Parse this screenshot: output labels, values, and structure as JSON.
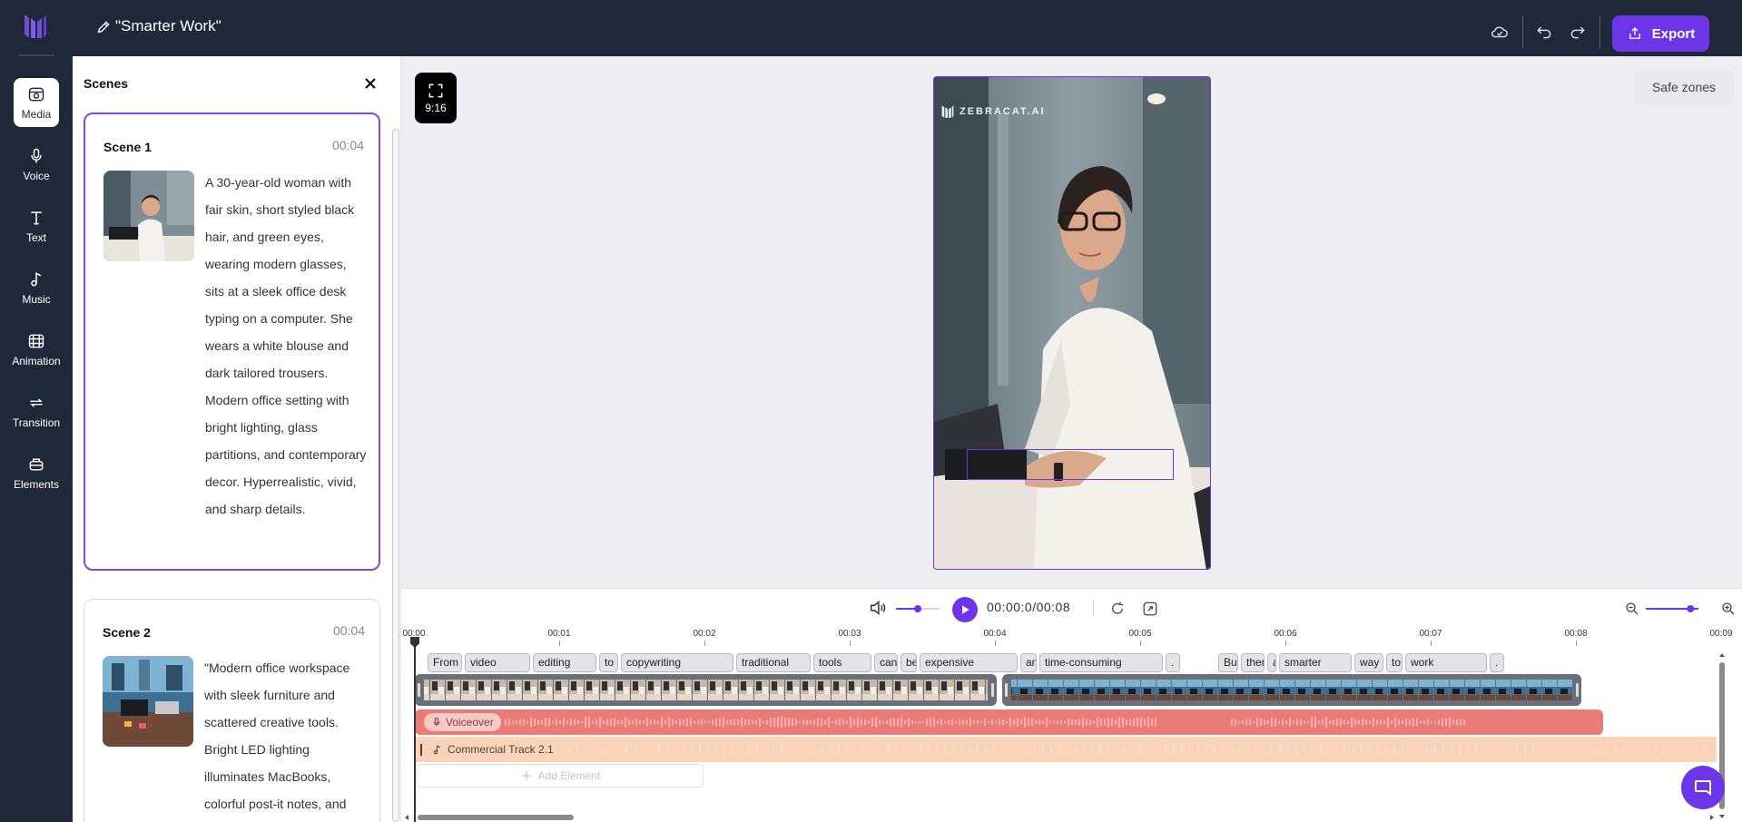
{
  "header": {
    "project_title": "\"Smarter Work\"",
    "export_label": "Export",
    "icons": [
      "cloud-check-icon",
      "undo-icon",
      "redo-icon",
      "export-upload-icon"
    ]
  },
  "sidebar": {
    "items": [
      {
        "label": "Media",
        "icon": "media-icon",
        "active": true
      },
      {
        "label": "Voice",
        "icon": "microphone-icon"
      },
      {
        "label": "Text",
        "icon": "text-icon"
      },
      {
        "label": "Music",
        "icon": "music-note-icon"
      },
      {
        "label": "Animation",
        "icon": "film-icon"
      },
      {
        "label": "Transition",
        "icon": "transition-icon"
      },
      {
        "label": "Elements",
        "icon": "elements-icon"
      }
    ]
  },
  "scenes_panel": {
    "title": "Scenes",
    "scenes": [
      {
        "name": "Scene 1",
        "duration": "00:04",
        "description": "A 30-year-old woman with fair skin, short styled black hair, and green eyes, wearing modern glasses, sits at a sleek office desk typing on a computer. She wears a white blouse and dark tailored trousers. Modern office setting with bright lighting, glass partitions, and contemporary decor. Hyperrealistic, vivid, and sharp details."
      },
      {
        "name": "Scene 2",
        "duration": "00:04",
        "description": "\"Modern office workspace with sleek furniture and scattered creative tools. Bright LED lighting illuminates MacBooks, colorful post-it notes, and"
      }
    ]
  },
  "preview": {
    "aspect_ratio": "9:16",
    "safe_zones_label": "Safe zones",
    "watermark": "ZEBRACAT.AI"
  },
  "playback": {
    "time": "00:00:0/00:08",
    "volume_level": 0.5,
    "zoom_level": 0.85
  },
  "timeline": {
    "ruler": [
      "00:00",
      "00:01",
      "00:02",
      "00:03",
      "00:04",
      "00:05",
      "00:06",
      "00:07",
      "00:08",
      "00:09"
    ],
    "words": [
      "From",
      "video",
      "editing",
      "to",
      "copywriting",
      "traditional",
      "tools",
      "can",
      "be",
      "expensive",
      "and",
      "time-consuming",
      ".",
      "But",
      "there",
      "a",
      "smarter",
      "way",
      "to",
      "work",
      "."
    ],
    "voiceover_label": "Voiceover",
    "music_label": "Commercial Track 2.1",
    "add_element_label": "Add Element"
  },
  "colors": {
    "accent": "#6b35e8",
    "nav_bg": "#1f2838",
    "voiceover": "#ea7b76",
    "music": "#fbd3b8"
  }
}
